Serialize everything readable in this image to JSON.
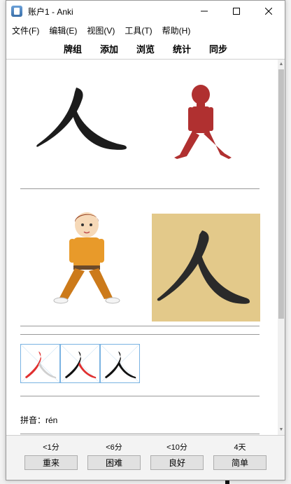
{
  "window": {
    "title": "账户1 - Anki"
  },
  "menu": [
    "文件(F)",
    "编辑(E)",
    "视图(V)",
    "工具(T)",
    "帮助(H)"
  ],
  "toolbar": [
    "牌组",
    "添加",
    "浏览",
    "统计",
    "同步"
  ],
  "card": {
    "pinyin_label": "拼音：rén",
    "character": "人"
  },
  "answer": {
    "intervals": [
      "<1分",
      "<6分",
      "<10分",
      "4天"
    ],
    "buttons": [
      "重来",
      "困难",
      "良好",
      "简单"
    ]
  }
}
